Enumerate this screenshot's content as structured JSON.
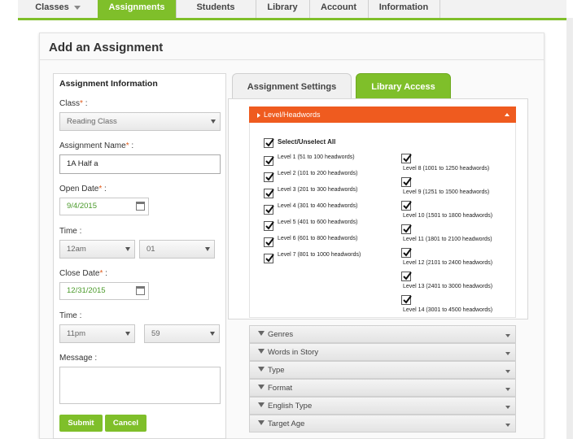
{
  "nav": {
    "items": [
      {
        "label": "Classes",
        "active": false,
        "dropdown": true
      },
      {
        "label": "Assignments",
        "active": true
      },
      {
        "label": "Students",
        "active": false
      },
      {
        "label": "Library",
        "active": false
      },
      {
        "label": "Account",
        "active": false
      },
      {
        "label": "Information",
        "active": false
      }
    ]
  },
  "page": {
    "title": "Add an Assignment"
  },
  "form": {
    "section_title": "Assignment Information",
    "class": {
      "label": "Class",
      "colon": " :",
      "value": "Reading Class"
    },
    "assignment_name": {
      "label": "Assignment Name",
      "colon": " :",
      "value": "1A Half a"
    },
    "open_date": {
      "label": "Open Date",
      "colon": " :",
      "value": "9/4/2015"
    },
    "open_time": {
      "label": "Time :",
      "hour": "12am",
      "minute": "01"
    },
    "close_date": {
      "label": "Close Date",
      "colon": " :",
      "value": "12/31/2015"
    },
    "close_time": {
      "label": "Time :",
      "hour": "11pm",
      "minute": "59"
    },
    "message": {
      "label": "Message :",
      "value": ""
    },
    "required_mark": "*",
    "submit_label": "Submit",
    "cancel_label": "Cancel"
  },
  "tabs": [
    {
      "label": "Assignment Settings",
      "active": false
    },
    {
      "label": "Library Access",
      "active": true
    }
  ],
  "library": {
    "level_header": "Level/Headwords",
    "select_all_label": "Select/Unselect All",
    "levels_left": [
      "Level 1 (51 to 100 headwords)",
      "Level 2 (101 to 200 headwords)",
      "Level 3 (201 to 300 headwords)",
      "Level 4 (301 to 400 headwords)",
      "Level 5 (401 to 600 headwords)",
      "Level 6 (601 to 800 headwords)",
      "Level 7 (801 to 1000 headwords)"
    ],
    "levels_right": [
      "Level 8 (1001 to 1250 headwords)",
      "Level 9 (1251 to 1500 headwords)",
      "Level 10 (1501 to 1800 headwords)",
      "Level 11 (1801 to 2100 headwords)",
      "Level 12 (2101 to 2400 headwords)",
      "Level 13 (2401 to 3000 headwords)",
      "Level 14 (3001 to 4500 headwords)"
    ],
    "filters": [
      "Genres",
      "Words in Story",
      "Type",
      "Format",
      "English Type",
      "Target Age"
    ]
  },
  "colors": {
    "accent_green": "#7fbf2a",
    "accent_orange": "#ef5b1f"
  }
}
